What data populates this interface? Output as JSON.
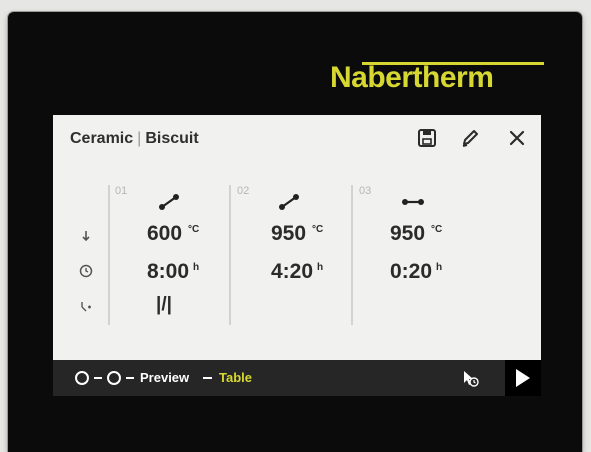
{
  "brand": {
    "logo_text": "Nabertherm",
    "color": "#d6d831"
  },
  "program": {
    "category": "Ceramic",
    "separator": "|",
    "name": "Biscuit"
  },
  "header_icons": [
    "save-icon",
    "edit-icon",
    "close-icon"
  ],
  "row_icons": [
    "arrow-down-icon",
    "clock-icon",
    "valve-icon"
  ],
  "segments": [
    {
      "number": "01",
      "glyph": "ramp-up-icon",
      "temperature": "600",
      "temp_unit": "°C",
      "time": "8:00",
      "time_unit": "h",
      "extra": "|/|"
    },
    {
      "number": "02",
      "glyph": "ramp-up-icon",
      "temperature": "950",
      "temp_unit": "°C",
      "time": "4:20",
      "time_unit": "h"
    },
    {
      "number": "03",
      "glyph": "hold-icon",
      "temperature": "950",
      "temp_unit": "°C",
      "time": "0:20",
      "time_unit": "h"
    }
  ],
  "bottom_bar": {
    "preview_label": "Preview",
    "table_label": "Table",
    "active_view": "Table",
    "active_color": "#d6d831",
    "icons": [
      "schedule-start-icon",
      "play-icon"
    ]
  }
}
